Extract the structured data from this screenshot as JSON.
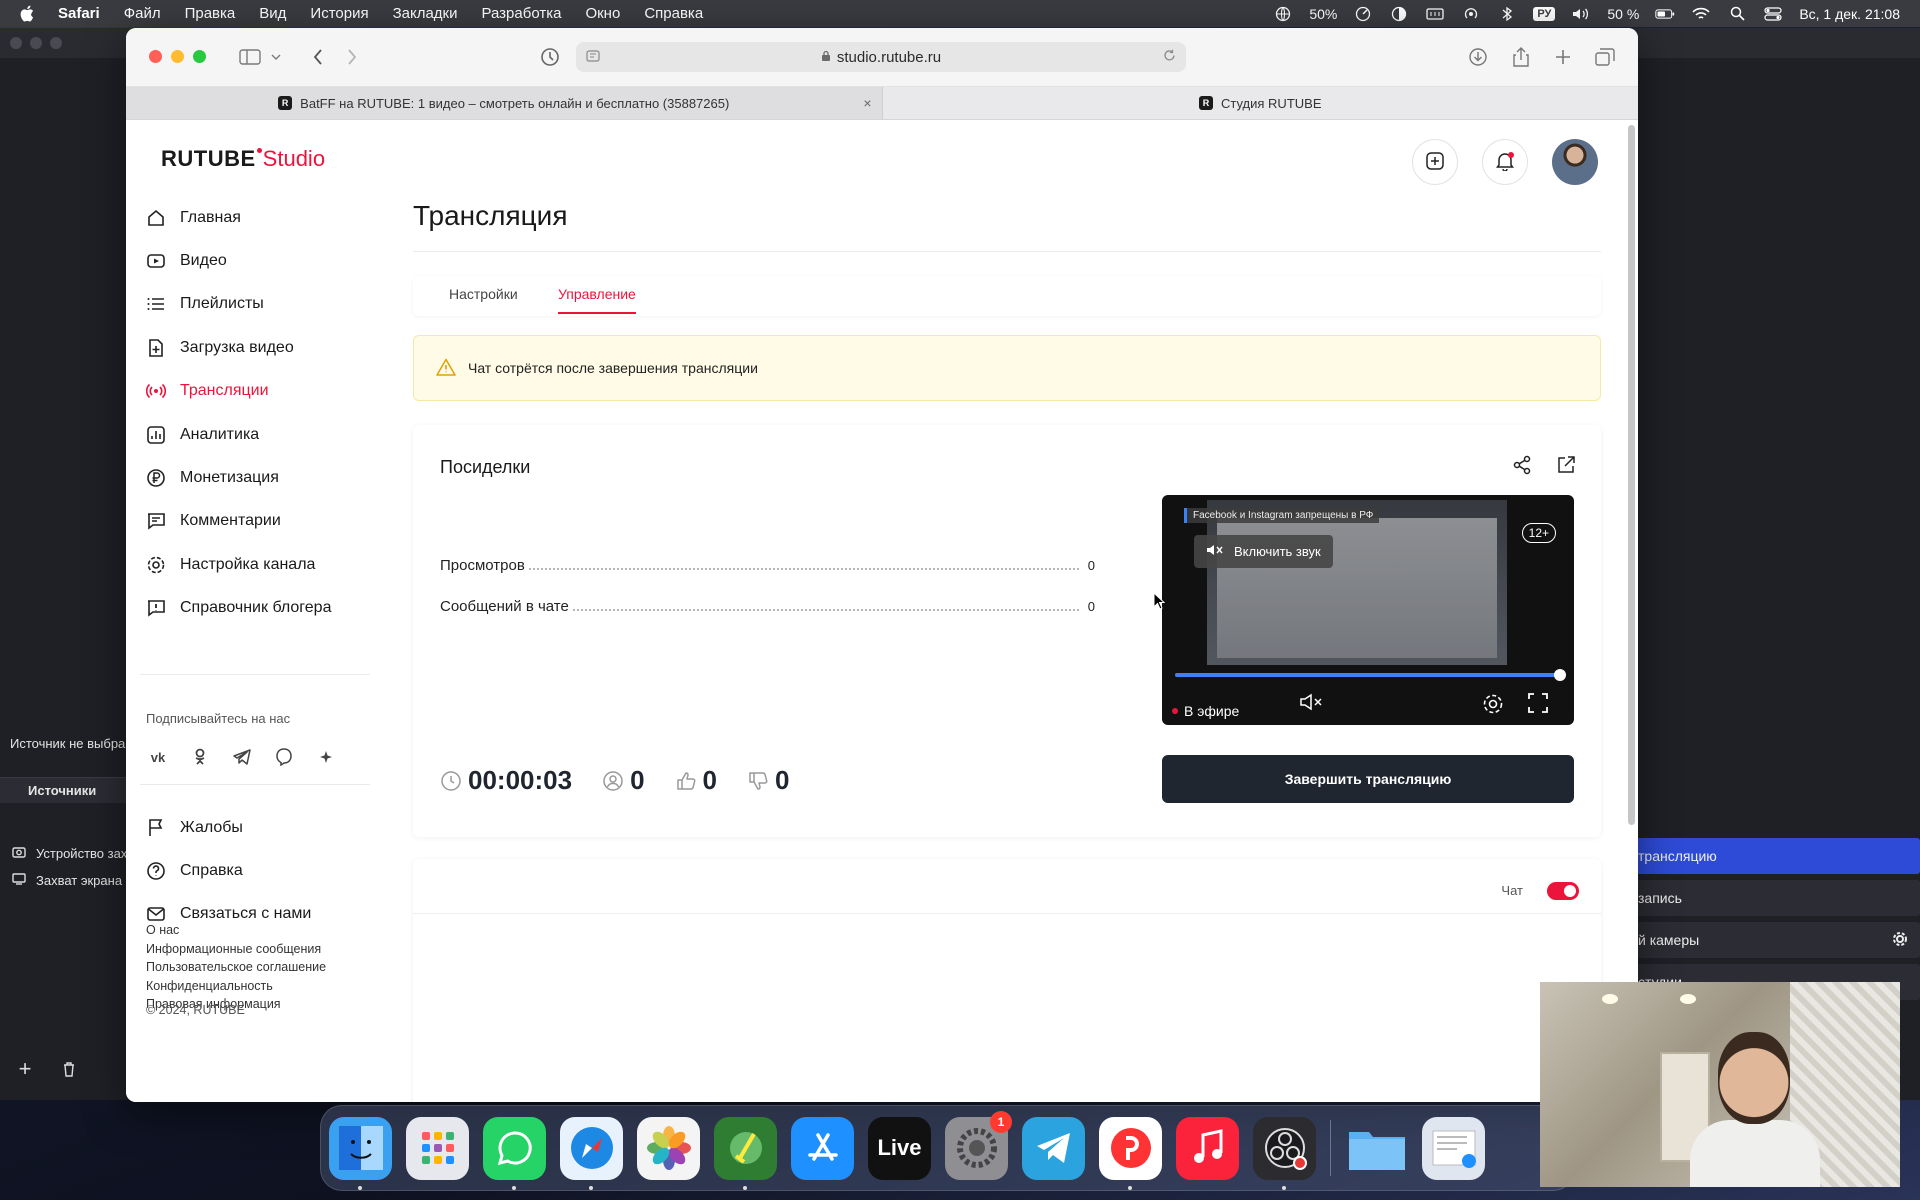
{
  "menubar": {
    "app_name": "Safari",
    "items": [
      "Файл",
      "Правка",
      "Вид",
      "История",
      "Закладки",
      "Разработка",
      "Окно",
      "Справка"
    ],
    "battery_percent_a": "50%",
    "input_lang": "РУ",
    "battery_percent_b": "50 %",
    "clock": "Вс, 1 дек.  21:08"
  },
  "browser": {
    "url": "studio.rutube.ru",
    "tabs": [
      {
        "title": "BatFF на RUTUBE: 1 видео – смотреть онлайн и бесплатно (35887265)",
        "fav": "R"
      },
      {
        "title": "Студия RUTUBE",
        "fav": "R"
      }
    ]
  },
  "brand": {
    "logo_main": "RUTUBE",
    "logo_sub": "Studio",
    "accent_color": "#ed143b",
    "dark_color": "#1f262f"
  },
  "sidebar": {
    "items": [
      {
        "label": "Главная",
        "icon": "home-icon"
      },
      {
        "label": "Видео",
        "icon": "video-icon"
      },
      {
        "label": "Плейлисты",
        "icon": "playlist-icon"
      },
      {
        "label": "Загрузка видео",
        "icon": "upload-icon"
      },
      {
        "label": "Трансляции",
        "icon": "broadcast-icon",
        "active": true
      },
      {
        "label": "Аналитика",
        "icon": "analytics-icon"
      },
      {
        "label": "Монетизация",
        "icon": "monetization-icon"
      },
      {
        "label": "Комментарии",
        "icon": "comments-icon"
      },
      {
        "label": "Настройка канала",
        "icon": "settings-icon"
      },
      {
        "label": "Справочник блогера",
        "icon": "guide-icon"
      }
    ],
    "follow_title": "Подписывайтесь на нас",
    "socials": [
      "vk-icon",
      "ok-icon",
      "telegram-icon",
      "viber-icon",
      "plus-icon"
    ],
    "bottom_items": [
      {
        "label": "Жалобы",
        "icon": "flag-icon"
      },
      {
        "label": "Справка",
        "icon": "help-icon"
      },
      {
        "label": "Связаться с нами",
        "icon": "mail-icon"
      }
    ],
    "footer_links": [
      "О нас",
      "Информационные сообщения",
      "Пользовательское соглашение",
      "Конфиденциальность",
      "Правовая информация"
    ],
    "copyright": "© 2024, RUTUBE"
  },
  "main": {
    "title": "Трансляция",
    "tabs": [
      {
        "label": "Настройки"
      },
      {
        "label": "Управление",
        "active": true
      }
    ],
    "warning": "Чат сотрётся после завершения трансляции",
    "stream": {
      "title": "Посиделки",
      "stats": [
        {
          "label": "Просмотров",
          "value": "0"
        },
        {
          "label": "Сообщений в чате",
          "value": "0"
        }
      ],
      "player": {
        "banner": "Facebook и Instagram запрещены в РФ",
        "age": "12+",
        "unmute": "Включить звук",
        "live_label": "В эфире",
        "progress": 1.0
      },
      "finish_button": "Завершить трансляцию",
      "timer": "00:00:03",
      "viewers": "0",
      "likes": "0",
      "dislikes": "0"
    },
    "chat": {
      "label": "Чат",
      "enabled": true
    }
  },
  "obs": {
    "no_source": "Источник не выбран",
    "sources_title": "Источники",
    "sources": [
      "Устройство захвата",
      "Захват экрана"
    ],
    "controls": [
      "трансляцию",
      "запись",
      "й камеры",
      "студии"
    ]
  },
  "dock": {
    "apps": [
      {
        "name": "finder-icon",
        "color": "#3aa0f0"
      },
      {
        "name": "launchpad-icon",
        "color": "#e6e8ee"
      },
      {
        "name": "whatsapp-icon",
        "color": "#25d366"
      },
      {
        "name": "safari-icon",
        "color": "#1e88e5"
      },
      {
        "name": "photos-icon",
        "color": "#f4f4f4"
      },
      {
        "name": "cleaner-icon",
        "color": "#2e7d32"
      },
      {
        "name": "appstore-icon",
        "color": "#1e90ff"
      },
      {
        "name": "live-icon",
        "color": "#111111",
        "text": "Live"
      },
      {
        "name": "system-settings-icon",
        "color": "#8e8e93",
        "badge": "1"
      },
      {
        "name": "telegram-icon",
        "color": "#2aa3de"
      },
      {
        "name": "yandex-browser-icon",
        "color": "#ffffff"
      },
      {
        "name": "music-icon",
        "color": "#fa233b"
      },
      {
        "name": "obs-icon",
        "color": "#2b2b30"
      },
      {
        "name": "folder-icon",
        "color": "#5ab0f0"
      },
      {
        "name": "downloads-icon",
        "color": "#dfe6ef"
      }
    ]
  }
}
